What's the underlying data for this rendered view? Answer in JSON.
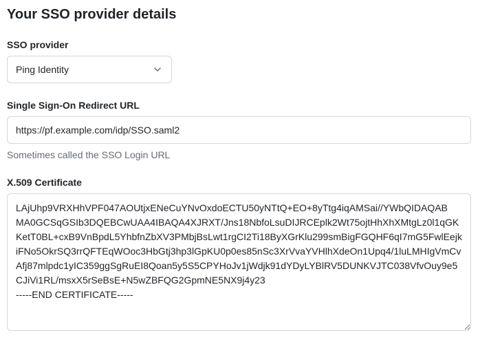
{
  "section_title": "Your SSO provider details",
  "provider": {
    "label": "SSO provider",
    "selected": "Ping Identity"
  },
  "redirect_url": {
    "label": "Single Sign-On Redirect URL",
    "value": "https://pf.example.com/idp/SSO.saml2",
    "helper": "Sometimes called the SSO Login URL"
  },
  "certificate": {
    "label": "X.509 Certificate",
    "value": "LAjUhp9VRXHhVPF047AOUtjxENeCuYNvOxdoECTU50yNTtQ+EO+8yTtg4iqAMSai//YWbQIDAQAB\nMA0GCSqGSIb3DQEBCwUAA4IBAQA4XJRXT/Jns18NbfoLsuDIJRCEplk2Wt75ojtHhXhXMtgLz0l1qGKKetT0BL+cxB9VnBpdL5YhbfnZbXV3PMbjBsLwt1rgCI2Ti18ByXGrKlu299smBigFGQHF6qI7mG5FwlEejkiFNo5OkrSQ3rrQFTEqWOoc3HbGtj3hp3lGpKU0p0es85nSc3XrVvaYVHlhXdeOn1Upq4/1luLMHIgVmCvAfj87mlpdc1yIC359ggSgRuEI8Qoan5y5S5CPYHoJv1jWdjk91dYDyLYBlRV5DUNKVJTC038VfvOuy9e5CJiVi1RL/msxX5rSeBsE+N5wZBFQG2GpmNE5NX9j4y23\n-----END CERTIFICATE-----"
  }
}
